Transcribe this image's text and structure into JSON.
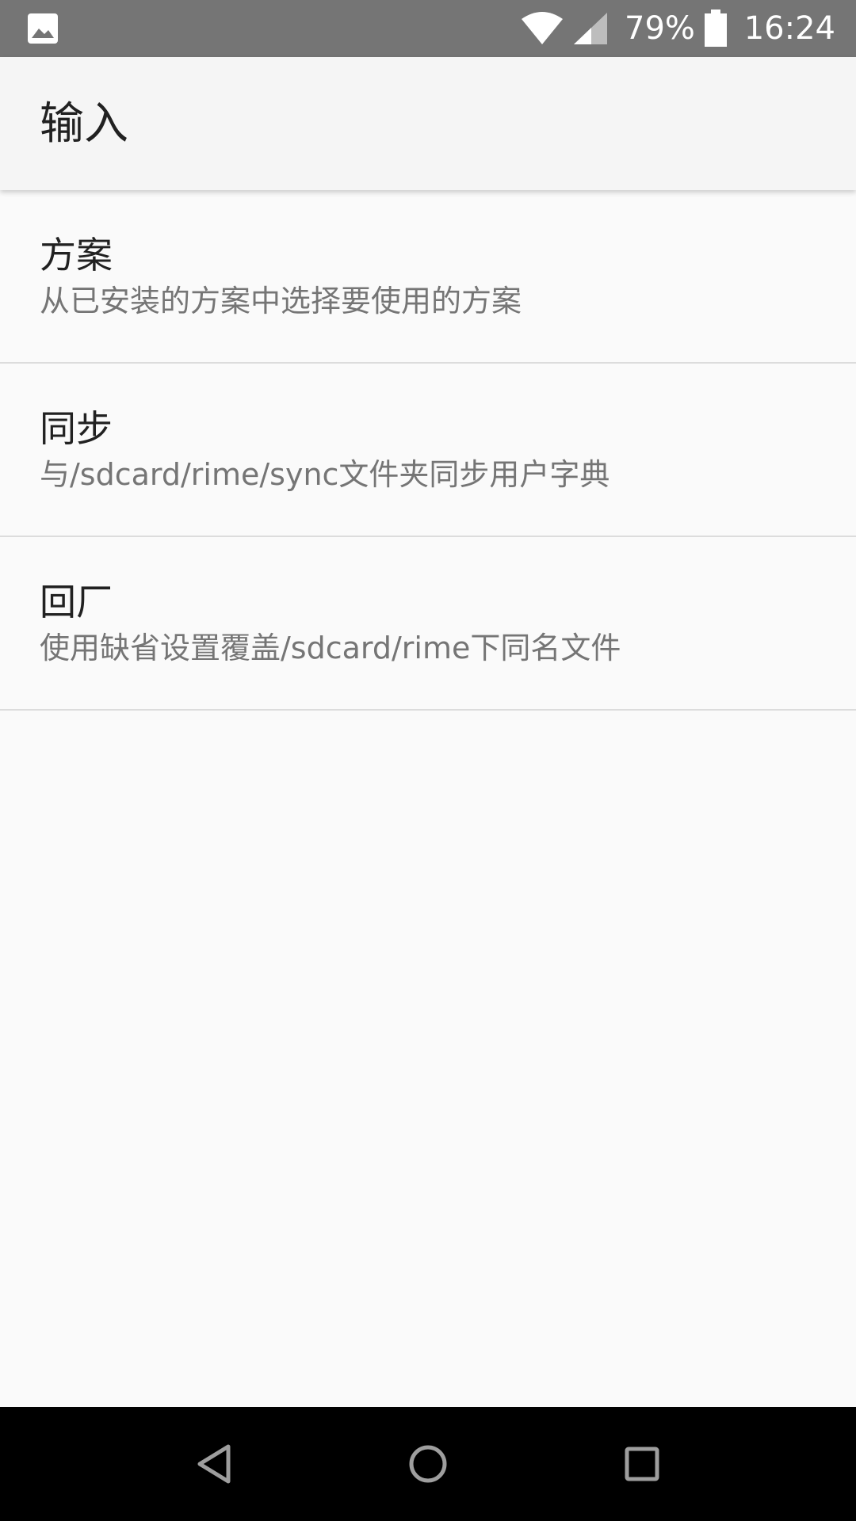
{
  "status_bar": {
    "notification_icon": "image-icon",
    "wifi_icon": "wifi-icon",
    "signal_icon": "cell-signal-icon",
    "battery_percent": "79%",
    "battery_icon": "battery-icon",
    "time": "16:24"
  },
  "app_bar": {
    "title": "输入"
  },
  "preferences": [
    {
      "title": "方案",
      "summary": "从已安装的方案中选择要使用的方案"
    },
    {
      "title": "同步",
      "summary": "与/sdcard/rime/sync文件夹同步用户字典"
    },
    {
      "title": "回厂",
      "summary": "使用缺省设置覆盖/sdcard/rime下同名文件"
    }
  ],
  "nav_bar": {
    "back_icon": "back-icon",
    "home_icon": "home-icon",
    "recents_icon": "recents-icon"
  },
  "colors": {
    "status_bar": "#757575",
    "app_bar": "#f5f5f5",
    "background": "#fafafa",
    "nav_bar": "#000000",
    "primary_text": "#212121",
    "secondary_text": "#757575",
    "divider": "#dcdcdc"
  }
}
